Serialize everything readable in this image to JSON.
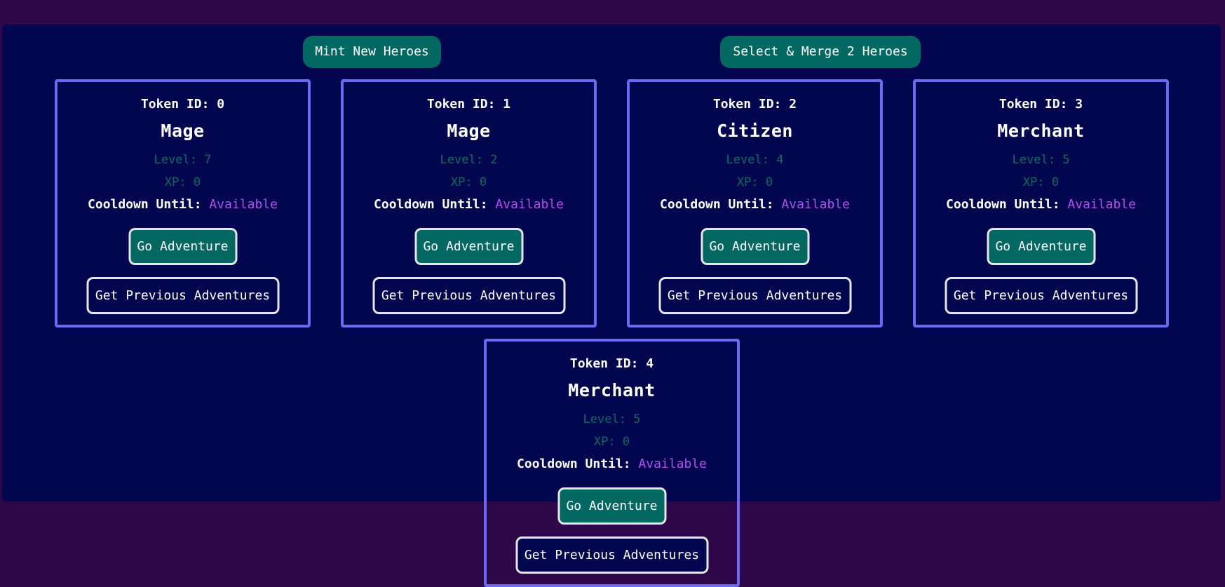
{
  "toolbar": {
    "mint_label": "Mint New Heroes",
    "merge_label": "Select & Merge 2 Heroes"
  },
  "labels": {
    "token_id_prefix": "Token ID: ",
    "level_prefix": "Level: ",
    "xp_prefix": "XP: ",
    "cooldown_label": "Cooldown Until:",
    "adventure_button": "Go Adventure",
    "previous_button": "Get Previous Adventures"
  },
  "heroes": [
    {
      "token_id": "0",
      "hero_class": "Mage",
      "level": "7",
      "xp": "0",
      "cooldown": "Available"
    },
    {
      "token_id": "1",
      "hero_class": "Mage",
      "level": "2",
      "xp": "0",
      "cooldown": "Available"
    },
    {
      "token_id": "2",
      "hero_class": "Citizen",
      "level": "4",
      "xp": "0",
      "cooldown": "Available"
    },
    {
      "token_id": "3",
      "hero_class": "Merchant",
      "level": "5",
      "xp": "0",
      "cooldown": "Available"
    },
    {
      "token_id": "4",
      "hero_class": "Merchant",
      "level": "5",
      "xp": "0",
      "cooldown": "Available"
    }
  ],
  "colors": {
    "page_background": "#2d0748",
    "panel_background": "#01064f",
    "card_border": "#6b6bf2",
    "button_teal": "#036862",
    "stat_text": "#0a6b5e",
    "cooldown_value": "#b84ef0"
  }
}
